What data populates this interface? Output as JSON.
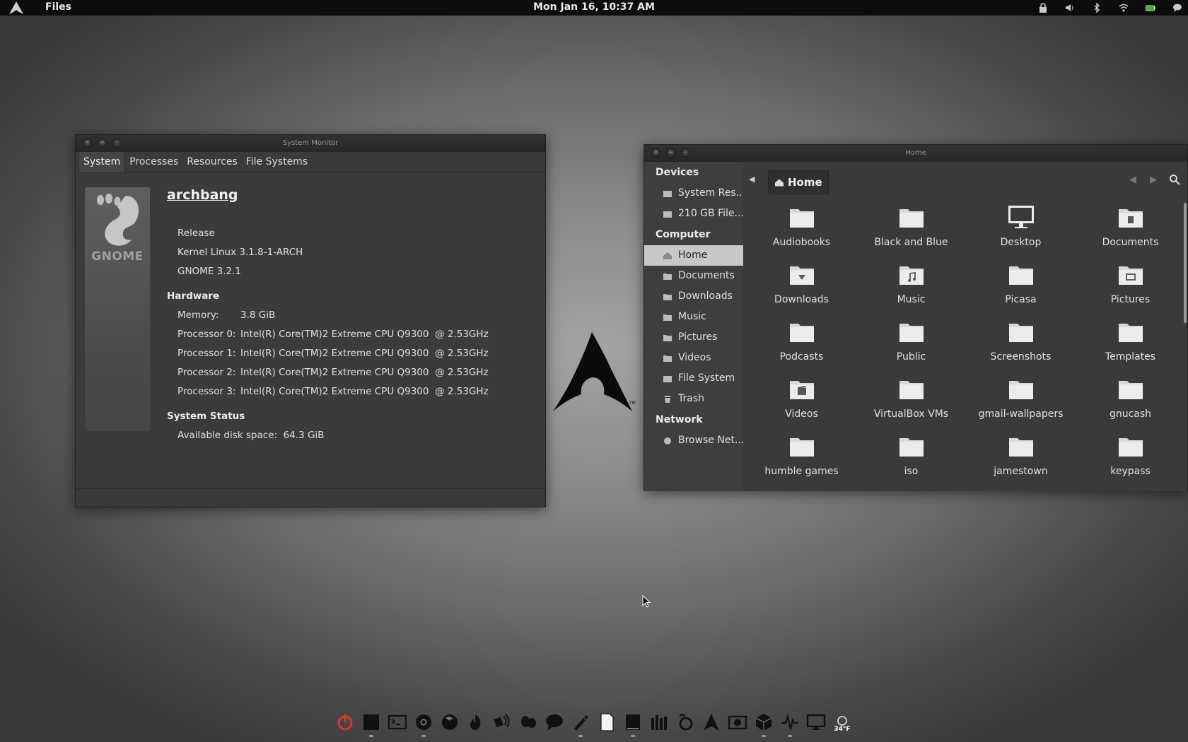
{
  "top_panel": {
    "app_menu": "Files",
    "clock": "Mon Jan 16, 10:37 AM",
    "tray_icons": [
      "lock-icon",
      "volume-icon",
      "bluetooth-icon",
      "wifi-icon",
      "battery-icon",
      "chat-icon"
    ]
  },
  "system_monitor": {
    "title": "System Monitor",
    "tabs": [
      "System",
      "Processes",
      "Resources",
      "File Systems"
    ],
    "logo_text": "GNOME",
    "hostname": "archbang",
    "release": "Release",
    "kernel": "Kernel Linux 3.1.8-1-ARCH",
    "gnome_version": "GNOME 3.2.1",
    "hardware_heading": "Hardware",
    "memory_label": "Memory:",
    "memory_value": "3.8 GiB",
    "processors": [
      {
        "label": "Processor 0:",
        "value": "Intel(R) Core(TM)2 Extreme CPU Q9300  @ 2.53GHz"
      },
      {
        "label": "Processor 1:",
        "value": "Intel(R) Core(TM)2 Extreme CPU Q9300  @ 2.53GHz"
      },
      {
        "label": "Processor 2:",
        "value": "Intel(R) Core(TM)2 Extreme CPU Q9300  @ 2.53GHz"
      },
      {
        "label": "Processor 3:",
        "value": "Intel(R) Core(TM)2 Extreme CPU Q9300  @ 2.53GHz"
      }
    ],
    "status_heading": "System Status",
    "disk_space": "Available disk space:  64.3 GiB"
  },
  "files": {
    "title": "Home",
    "sidebar": {
      "devices_heading": "Devices",
      "devices": [
        "System Res...",
        "210 GB File..."
      ],
      "computer_heading": "Computer",
      "computer": [
        "Home",
        "Documents",
        "Downloads",
        "Music",
        "Pictures",
        "Videos",
        "File System",
        "Trash"
      ],
      "network_heading": "Network",
      "network": [
        "Browse Net..."
      ]
    },
    "path": "Home",
    "items": [
      {
        "name": "Audiobooks",
        "icon": "folder-icon"
      },
      {
        "name": "Black and Blue",
        "icon": "folder-icon"
      },
      {
        "name": "Desktop",
        "icon": "desktop-icon"
      },
      {
        "name": "Documents",
        "icon": "folder-documents-icon"
      },
      {
        "name": "Downloads",
        "icon": "folder-download-icon"
      },
      {
        "name": "Music",
        "icon": "folder-music-icon"
      },
      {
        "name": "Picasa",
        "icon": "folder-icon"
      },
      {
        "name": "Pictures",
        "icon": "folder-pictures-icon"
      },
      {
        "name": "Podcasts",
        "icon": "folder-icon"
      },
      {
        "name": "Public",
        "icon": "folder-icon"
      },
      {
        "name": "Screenshots",
        "icon": "folder-icon"
      },
      {
        "name": "Templates",
        "icon": "folder-icon"
      },
      {
        "name": "Videos",
        "icon": "folder-videos-icon"
      },
      {
        "name": "VirtualBox VMs",
        "icon": "folder-icon"
      },
      {
        "name": "gmail-wallpapers",
        "icon": "folder-icon"
      },
      {
        "name": "gnucash",
        "icon": "folder-icon"
      },
      {
        "name": "humble games",
        "icon": "folder-icon"
      },
      {
        "name": "iso",
        "icon": "folder-icon"
      },
      {
        "name": "jamestown",
        "icon": "folder-icon"
      },
      {
        "name": "keypass",
        "icon": "folder-icon"
      }
    ]
  },
  "dock": {
    "weather_temp": "34°F",
    "items": [
      "power-icon",
      "square-icon",
      "terminal-icon",
      "chrome-icon",
      "firefox-icon",
      "flame-icon",
      "network-icon",
      "pidgin-icon",
      "chat-bubble-icon",
      "pen-icon",
      "document-icon",
      "book-icon",
      "library-icon",
      "sync-icon",
      "arch-icon",
      "camera-icon",
      "cube-icon",
      "activity-icon",
      "monitor-icon",
      "weather-icon"
    ]
  },
  "colors": {
    "panel_bg": "#0d0d0d",
    "window_bg": "#3b3b3b",
    "selection_bg": "#c8c8c8",
    "folder": "#d9d9d9",
    "power_red": "#d43a2a"
  }
}
